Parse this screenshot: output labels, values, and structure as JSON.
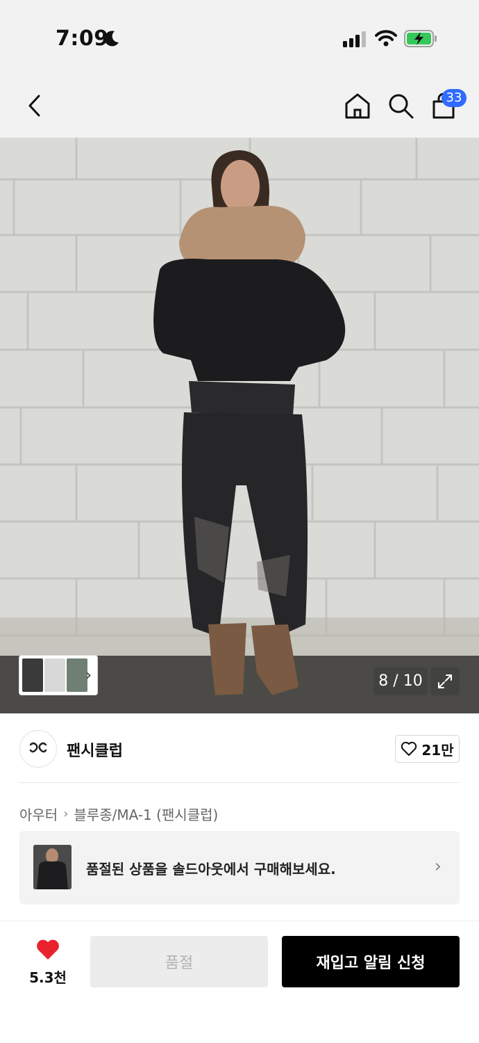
{
  "status_bar": {
    "time": "7:09"
  },
  "header": {
    "back_icon": "chevron-left-icon",
    "home_icon": "home-icon",
    "search_icon": "search-icon",
    "cart_icon": "shopping-bag-icon",
    "cart_count": "33"
  },
  "gallery": {
    "counter": "8 / 10",
    "current_index": 8,
    "total": 10,
    "expand_icon": "expand-icon"
  },
  "brand": {
    "logo_text": "ꔪ",
    "name": "팬시클럽",
    "likes": "21만"
  },
  "breadcrumb": {
    "items": [
      "아우터",
      "블루종/MA-1 (팬시클럽)"
    ]
  },
  "soldout_banner": {
    "text": "품절된 상품을 솔드아웃에서 구매해보세요."
  },
  "bottom_bar": {
    "like_count": "5.3천",
    "soldout_label": "품절",
    "restock_label": "재입고 알림 신청"
  },
  "colors": {
    "accent_badge": "#2f6bff",
    "heart": "#e8232e",
    "primary_button": "#000000",
    "disabled_button": "#ececec"
  }
}
